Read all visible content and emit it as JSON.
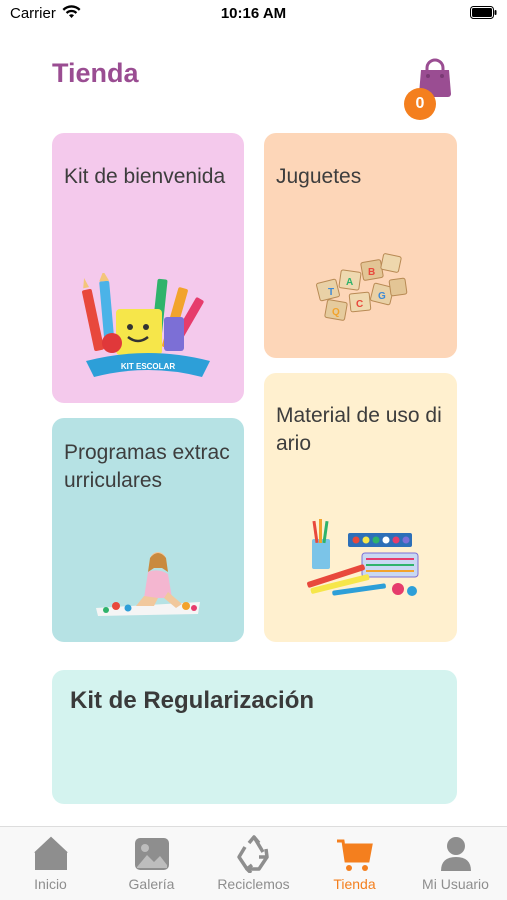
{
  "status_bar": {
    "carrier": "Carrier",
    "time": "10:16 AM"
  },
  "header": {
    "title": "Tienda",
    "cart_count": "0"
  },
  "cards": {
    "kit_bienvenida": {
      "title": "Kit de bienvenida"
    },
    "juguetes": {
      "title": "Juguetes"
    },
    "programas": {
      "title": "Programas extracurriculares"
    },
    "material": {
      "title": "Material de uso diario"
    },
    "regularizacion": {
      "title": "Kit de Regularización"
    }
  },
  "kit_illustration_text": "KIT ESCOLAR",
  "tabs": [
    {
      "label": "Inicio",
      "icon": "home-icon"
    },
    {
      "label": "Galería",
      "icon": "gallery-icon"
    },
    {
      "label": "Reciclemos",
      "icon": "recycle-icon"
    },
    {
      "label": "Tienda",
      "icon": "cart-icon",
      "active": true
    },
    {
      "label": "Mi Usuario",
      "icon": "user-icon"
    }
  ],
  "colors": {
    "accent": "#f47f1e",
    "title": "#9a4d92",
    "card_pink": "#f4c9ec",
    "card_peach": "#fdd6b8",
    "card_teal": "#b6e2e4",
    "card_cream": "#fff0cf",
    "card_mint": "#d4f3ef"
  }
}
